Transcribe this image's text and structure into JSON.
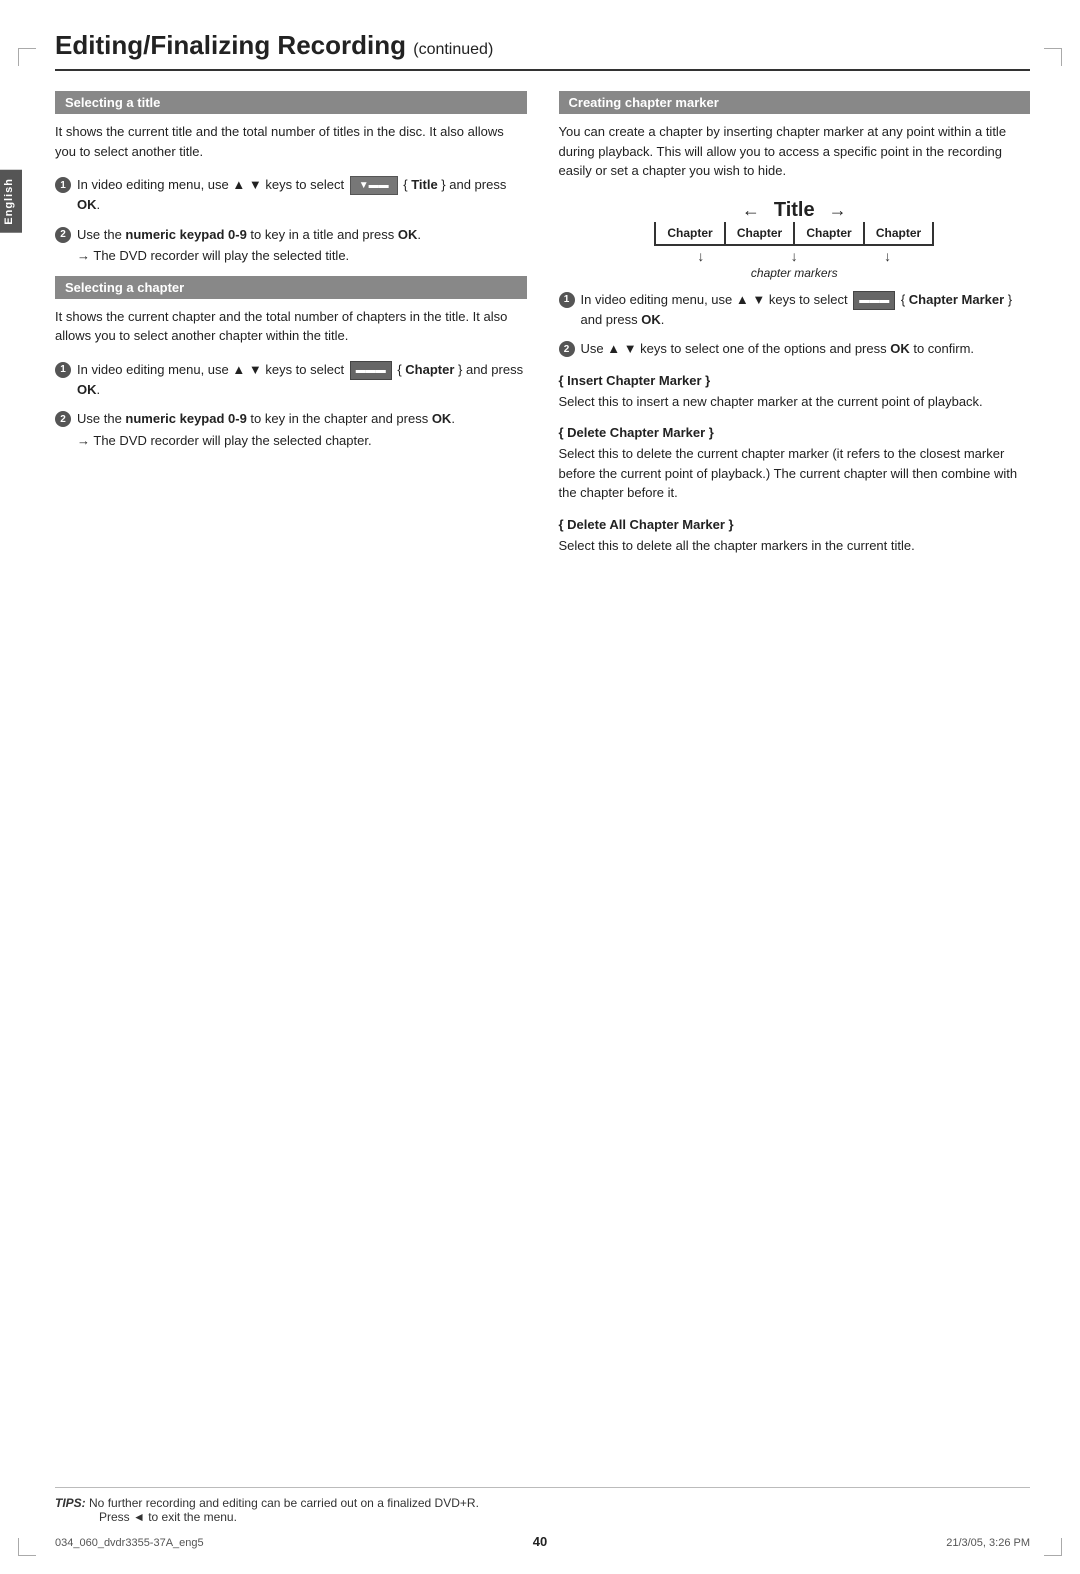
{
  "page": {
    "title": "Editing/Finalizing Recording",
    "title_continued": "continued",
    "side_tab": "English"
  },
  "left_col": {
    "section1": {
      "header": "Selecting a title",
      "body": "It shows the current title and the total number of titles in the disc. It also allows you to select another title.",
      "steps": [
        {
          "num": "1",
          "text_before": "In video editing menu, use ▲ ▼ keys to select",
          "icon": "title-btn",
          "text_after": "{ Title } and press OK."
        },
        {
          "num": "2",
          "text": "Use the numeric keypad 0-9 to key in a title and press OK.",
          "note": "The DVD recorder will play the selected title."
        }
      ]
    },
    "section2": {
      "header": "Selecting a chapter",
      "body": "It shows the current chapter and the total number of chapters in the title. It also allows you to select another chapter within the title.",
      "steps": [
        {
          "num": "1",
          "text_before": "In video editing menu, use ▲ ▼ keys to select",
          "icon": "chapter-btn",
          "text_after": "{ Chapter } and press OK."
        },
        {
          "num": "2",
          "text": "Use the numeric keypad 0-9 to key in the chapter and press OK.",
          "note": "The DVD recorder will play the selected chapter."
        }
      ]
    }
  },
  "right_col": {
    "section1": {
      "header": "Creating chapter marker",
      "body": "You can create a chapter by inserting chapter marker at any point within a title during playback. This will allow you to access a specific point in the recording easily or set a chapter you wish to hide."
    },
    "diagram": {
      "title_label": "Title",
      "chapters": [
        "Chapter",
        "Chapter",
        "Chapter",
        "Chapter"
      ],
      "markers_label": "chapter markers"
    },
    "steps": [
      {
        "num": "1",
        "text_before": "In video editing menu, use ▲ ▼ keys to select",
        "icon": "chapter-marker-btn",
        "text_after": "{ Chapter Marker } and press OK."
      },
      {
        "num": "2",
        "text": "Use ▲ ▼ keys to select one of the options and press OK to confirm."
      }
    ],
    "sub_sections": [
      {
        "heading": "{ Insert Chapter Marker }",
        "body": "Select this to insert a new chapter marker at the current point of playback."
      },
      {
        "heading": "{ Delete Chapter Marker }",
        "body": "Select this to delete the current chapter marker (it refers to the closest marker before the current point of playback.) The current chapter will then combine with the chapter before it."
      },
      {
        "heading": "{ Delete All Chapter Marker }",
        "body": "Select this to delete all the chapter markers in the current title."
      }
    ]
  },
  "tips": {
    "label": "TIPS:",
    "line1": "No further recording and editing can be carried out on a finalized DVD+R.",
    "line2": "Press ◄ to exit the menu."
  },
  "footer": {
    "left": "034_060_dvdr3355-37A_eng5",
    "center": "40",
    "right": "21/3/05, 3:26 PM"
  }
}
